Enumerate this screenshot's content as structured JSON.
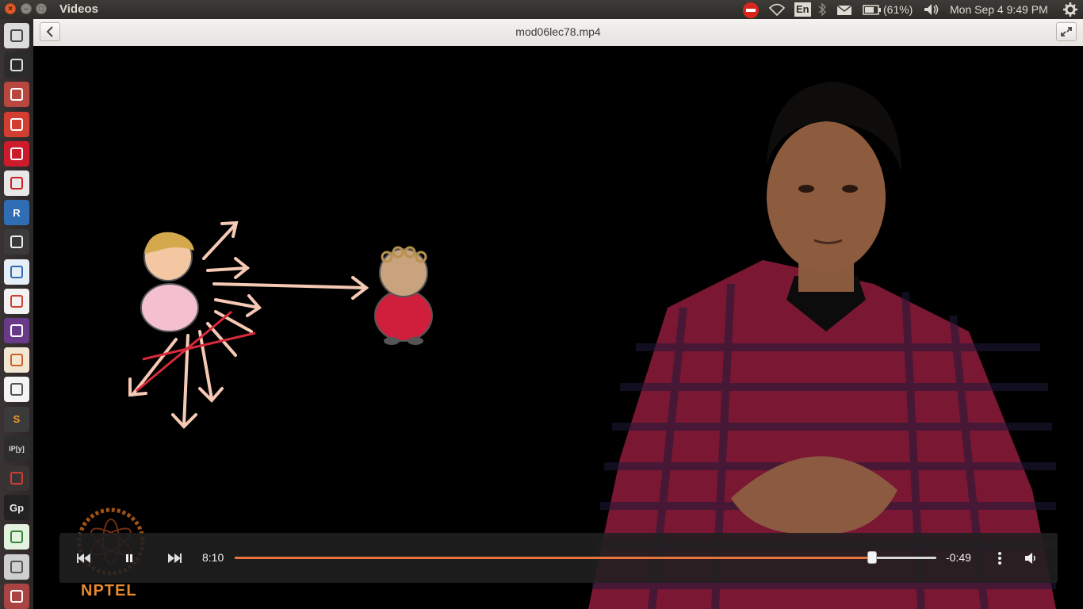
{
  "window": {
    "title": "Videos"
  },
  "tray": {
    "keyboard": "En",
    "battery": "(61%)",
    "clock": "Mon Sep  4  9:49 PM"
  },
  "header": {
    "file_title": "mod06lec78.mp4"
  },
  "launcher": {
    "items": [
      {
        "icon": "dash-icon"
      },
      {
        "icon": "terminal-icon"
      },
      {
        "icon": "files-icon"
      },
      {
        "icon": "chrome-icon"
      },
      {
        "icon": "opera-icon"
      },
      {
        "icon": "document-viewer-icon"
      },
      {
        "icon": "r-icon",
        "label": "R"
      },
      {
        "icon": "video-editor-icon"
      },
      {
        "icon": "writer-icon"
      },
      {
        "icon": "gmail-icon"
      },
      {
        "icon": "media-icon"
      },
      {
        "icon": "impress-icon"
      },
      {
        "icon": "text-editor-icon"
      },
      {
        "icon": "sublime-icon",
        "label": "S"
      },
      {
        "icon": "ipython-icon",
        "label": "IP[y]"
      },
      {
        "icon": "settings-wheel-icon"
      },
      {
        "icon": "gp-icon",
        "label": "Gp"
      },
      {
        "icon": "calc-icon"
      },
      {
        "icon": "drive-icon"
      },
      {
        "icon": "stack-icon"
      }
    ]
  },
  "video": {
    "watermark": "NPTEL"
  },
  "player": {
    "elapsed": "8:10",
    "remaining": "-0:49",
    "progress": 0.909
  },
  "colors": {
    "accent": "#e9743b"
  }
}
